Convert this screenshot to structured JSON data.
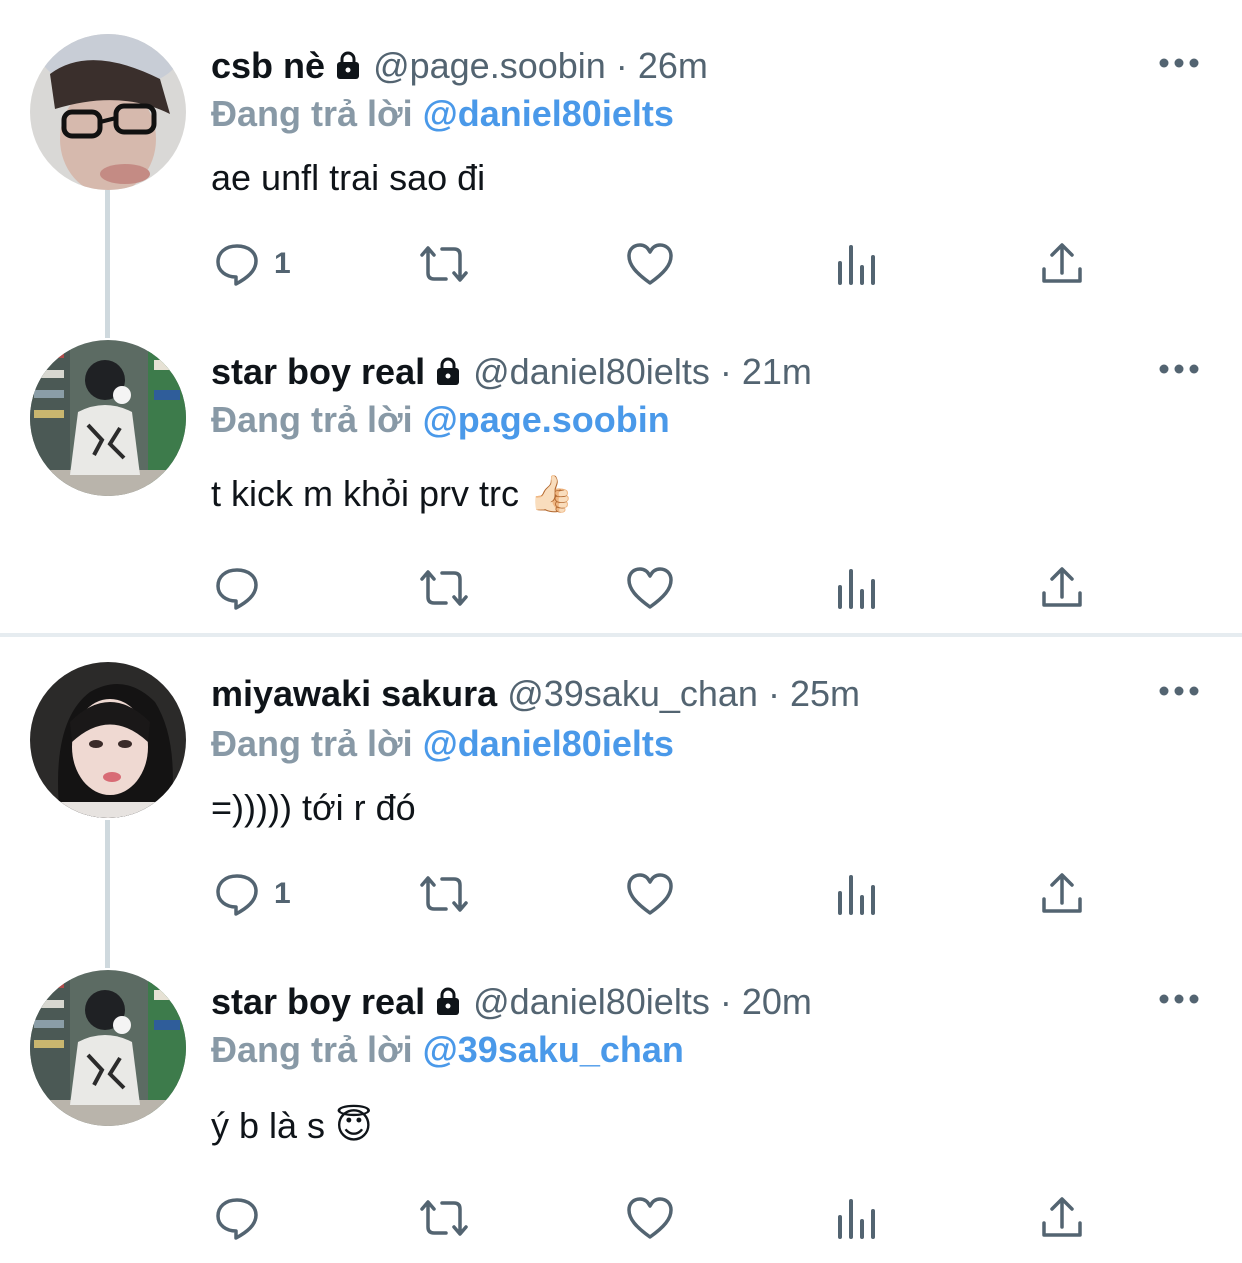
{
  "reply_prefix": "Đang trả lời",
  "tweets": [
    {
      "name": "csb nè",
      "locked": true,
      "handle": "@page.soobin",
      "dot": "·",
      "time": "26m",
      "reply_to": "@daniel80ielts",
      "text": "ae unfl trai sao đi",
      "reply_count": "1"
    },
    {
      "name": "star boy real",
      "locked": true,
      "handle": "@daniel80ielts",
      "dot": "·",
      "time": "21m",
      "reply_to": "@page.soobin",
      "text": " t kick m khỏi prv trc 👍🏻",
      "reply_count": ""
    },
    {
      "name": "miyawaki sakura",
      "locked": false,
      "handle": "@39saku_chan",
      "dot": "·",
      "time": "25m",
      "reply_to": "@daniel80ielts",
      "text": "=))))) tới r đó",
      "reply_count": "1"
    },
    {
      "name": "star boy real",
      "locked": true,
      "handle": "@daniel80ielts",
      "dot": "·",
      "time": "20m",
      "reply_to": "@39saku_chan",
      "text": "ý b là s 😇",
      "reply_count": ""
    }
  ],
  "icons": {
    "reply": "reply-icon",
    "retweet": "retweet-icon",
    "like": "heart-icon",
    "analytics": "analytics-icon",
    "share": "share-icon",
    "more": "more-icon",
    "lock": "lock-icon"
  },
  "colors": {
    "mention": "#4a99e9",
    "secondary": "#536471",
    "reply_prefix": "#8899a6",
    "thread_line": "#cfd9de"
  }
}
